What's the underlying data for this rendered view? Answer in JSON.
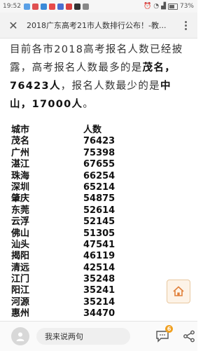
{
  "status_bar": {
    "time": "19:52",
    "battery": "73%"
  },
  "title_bar": {
    "title": "2018广东高考21市人数排行公布！-教..."
  },
  "article": {
    "p1_a": "目前各市2018高考报名人数已经披露，高考报名人数最多的是",
    "p1_b": "茂名，76423人",
    "p1_c": "，报名人数最少的是",
    "p1_d": "中山，17000人",
    "p1_e": "。"
  },
  "table": {
    "headers": [
      "城市",
      "人数"
    ],
    "rows": [
      [
        "茂名",
        "76423"
      ],
      [
        "广州",
        "75398"
      ],
      [
        "湛江",
        "67655"
      ],
      [
        "珠海",
        "66254"
      ],
      [
        "深圳",
        "65214"
      ],
      [
        "肇庆",
        "54875"
      ],
      [
        "东莞",
        "52614"
      ],
      [
        "云浮",
        "52145"
      ],
      [
        "佛山",
        "51305"
      ],
      [
        "汕头",
        "47541"
      ],
      [
        "揭阳",
        "46119"
      ],
      [
        "清远",
        "42514"
      ],
      [
        "江门",
        "35248"
      ],
      [
        "阳江",
        "35241"
      ],
      [
        "河源",
        "35214"
      ],
      [
        "惠州",
        "34470"
      ]
    ]
  },
  "bottom_bar": {
    "placeholder": "我来说两句",
    "comment_count": "6"
  }
}
